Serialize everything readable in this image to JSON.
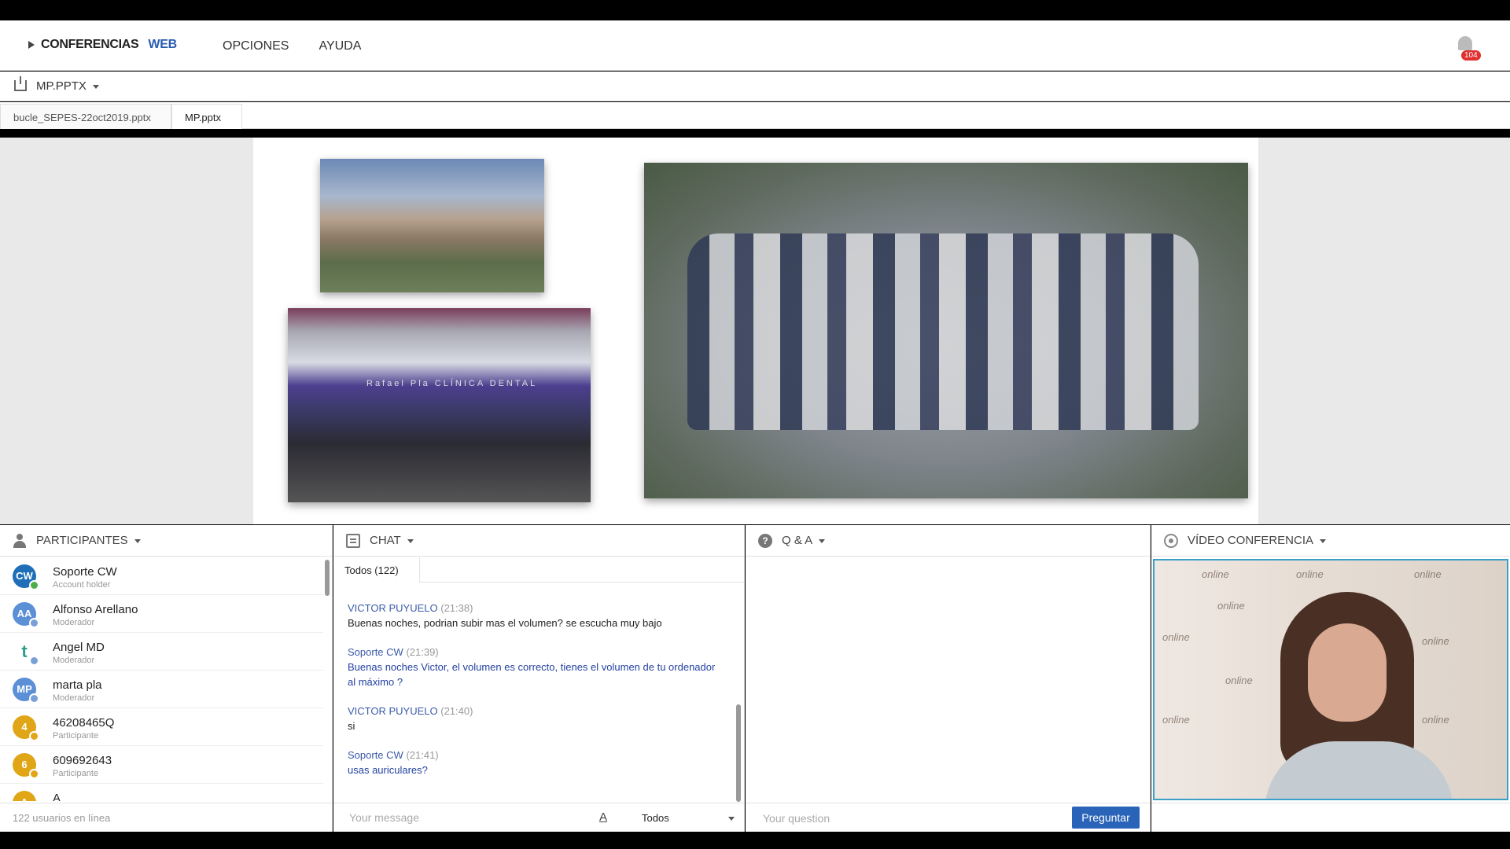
{
  "app": {
    "brand_part1": "CONFERENCIAS",
    "brand_part2": "WEB",
    "nav": [
      "OPCIONES",
      "AYUDA"
    ],
    "notification_count": "104"
  },
  "filebar": {
    "current_file": "MP.PPTX"
  },
  "tabs": [
    "bucle_SEPES-22oct2019.pptx",
    "MP.pptx"
  ],
  "slide": {
    "clinic_sign": "Rafael Pla   CLÍNICA DENTAL"
  },
  "participants": {
    "title": "PARTICIPANTES",
    "items": [
      {
        "initials": "CW",
        "name": "Soporte CW",
        "role": "Account holder",
        "color": "#1f6fb8"
      },
      {
        "initials": "AA",
        "name": "Alfonso Arellano",
        "role": "Moderador",
        "color": "#5b8fd6"
      },
      {
        "initials": "t",
        "name": "Angel MD",
        "role": "Moderador",
        "color": "#2e9e8a"
      },
      {
        "initials": "MP",
        "name": "marta pla",
        "role": "Moderador",
        "color": "#5b8fd6"
      },
      {
        "initials": "4",
        "name": "46208465Q",
        "role": "Participante",
        "color": "#e0a617"
      },
      {
        "initials": "6",
        "name": "609692643",
        "role": "Participante",
        "color": "#e0a617"
      },
      {
        "initials": "A",
        "name": "A",
        "role": "",
        "color": "#e0a617"
      }
    ],
    "footer": "122 usuarios en línea"
  },
  "chat": {
    "title": "CHAT",
    "tab": "Todos (122)",
    "messages": [
      {
        "who": "VICTOR PUYUELO",
        "time": "(21:38)",
        "text": "Buenas noches, podrian subir mas el volumen? se escucha muy bajo",
        "support": false
      },
      {
        "who": "Soporte CW",
        "time": "(21:39)",
        "text": "Buenas noches Victor, el volumen es correcto, tienes el volumen de tu ordenador al máximo ?",
        "support": true
      },
      {
        "who": "VICTOR PUYUELO",
        "time": "(21:40)",
        "text": "si",
        "support": false
      },
      {
        "who": "Soporte CW",
        "time": "(21:41)",
        "text": "usas auriculares?",
        "support": true
      }
    ],
    "input_placeholder": "Your message",
    "recipient": "Todos"
  },
  "qa": {
    "title": "Q & A",
    "input_placeholder": "Your question",
    "submit_label": "Preguntar"
  },
  "video": {
    "title": "VÍDEO CONFERENCIA",
    "watermark": "online"
  },
  "colors": {
    "brand_blue": "#2a5db0",
    "button_blue": "#2a64b8",
    "video_border": "#3aa0c8",
    "badge_red": "#e03030"
  }
}
